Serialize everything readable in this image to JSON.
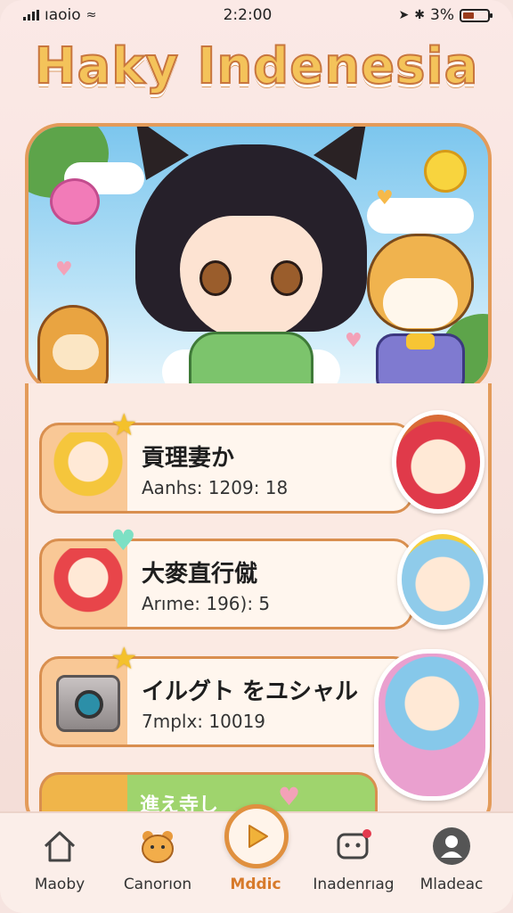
{
  "status_bar": {
    "carrier": "ıaoio",
    "time": "2:2:00",
    "battery": "3%"
  },
  "app": {
    "title": "Haky Indenesia"
  },
  "hero": {
    "image": "anime-cat-girl-banner"
  },
  "cards": [
    {
      "name": "貢理妻か",
      "meta": "Aanhs: 1209: 18",
      "badge": "star-icon"
    },
    {
      "name": "大麥直行僦",
      "meta": "Arıme: 196): 5",
      "badge": "heart-icon"
    },
    {
      "name": "イルグト をユシャル",
      "meta": "7mplx: 10019",
      "badge": "star-icon"
    },
    {
      "name": "進え寺し",
      "meta": ""
    }
  ],
  "tabs": [
    {
      "label": "Maoby",
      "icon": "home-icon"
    },
    {
      "label": "Canorıon",
      "icon": "bear-icon"
    },
    {
      "label": "Mddic",
      "icon": "play-icon",
      "active": true
    },
    {
      "label": "Inadenrıag",
      "icon": "chat-bot-icon"
    },
    {
      "label": "Mladeac",
      "icon": "profile-icon"
    }
  ],
  "colors": {
    "accent": "#e0903f",
    "title_fill": "#f4c35a",
    "title_stroke": "#c8763e",
    "background": "#fbe9e6"
  }
}
